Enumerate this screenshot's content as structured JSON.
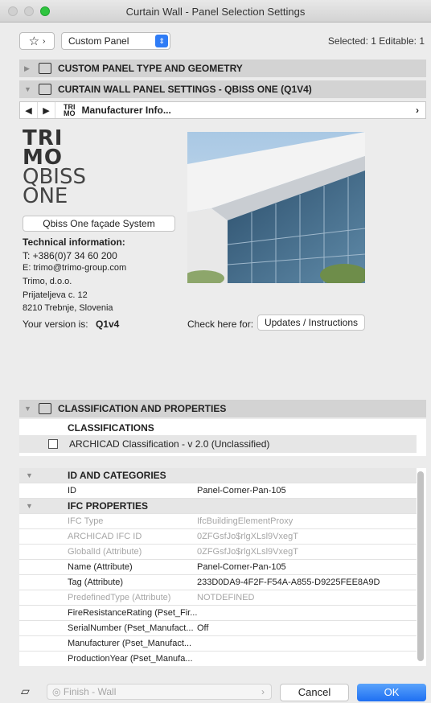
{
  "window": {
    "title": "Curtain Wall - Panel Selection Settings"
  },
  "toolbar": {
    "favorites_icon": "star-icon",
    "panel_type": "Custom Panel",
    "selection_info": "Selected: 1 Editable: 1"
  },
  "sections": {
    "type_geometry": "CUSTOM PANEL TYPE AND GEOMETRY",
    "panel_settings": "CURTAIN WALL PANEL SETTINGS - QBISS ONE (Q1V4)",
    "classification": "CLASSIFICATION AND PROPERTIES"
  },
  "nav": {
    "page_title": "Manufacturer Info...",
    "logo_text": "TRI MO"
  },
  "manufacturer": {
    "logo_lines": [
      "TRI",
      "MO",
      "QBISS",
      "ONE"
    ],
    "system_button": "Qbiss One façade System",
    "tech_header": "Technical information:",
    "phone": "T: +386(0)7 34 60 200",
    "email": "E: trimo@trimo-group.com",
    "company": "Trimo, d.o.o.",
    "street": "Prijateljeva c. 12",
    "city": "8210 Trebnje, Slovenia",
    "version_label": "Your version is:",
    "version_value": "Q1v4",
    "check_label": "Check here for:",
    "updates_button": "Updates / Instructions"
  },
  "classifications": {
    "header": "CLASSIFICATIONS",
    "item": "ARCHICAD Classification - v 2.0 (Unclassified)"
  },
  "properties": {
    "groups": {
      "id_categories": "ID AND CATEGORIES",
      "ifc": "IFC PROPERTIES"
    },
    "rows": [
      {
        "name": "ID",
        "value": "Panel-Corner-Pan-105"
      },
      {
        "name": "IFC Type",
        "value": "IfcBuildingElementProxy"
      },
      {
        "name": "ARCHICAD IFC ID",
        "value": "0ZFGsfJo$rlgXLsl9VxegT"
      },
      {
        "name": "GlobalId (Attribute)",
        "value": "0ZFGsfJo$rlgXLsl9VxegT"
      },
      {
        "name": "Name (Attribute)",
        "value": "Panel-Corner-Pan-105"
      },
      {
        "name": "Tag (Attribute)",
        "value": "233D0DA9-4F2F-F54A-A855-D9225FEE8A9D"
      },
      {
        "name": "PredefinedType (Attribute)",
        "value": "NOTDEFINED"
      },
      {
        "name": "FireResistanceRating (Pset_Fir...",
        "value": ""
      },
      {
        "name": "SerialNumber (Pset_Manufact...",
        "value": "Off"
      },
      {
        "name": "Manufacturer (Pset_Manufact...",
        "value": ""
      },
      {
        "name": "ProductionYear (Pset_Manufa...",
        "value": ""
      }
    ]
  },
  "footer": {
    "finish_value": "Finish - Wall",
    "cancel": "Cancel",
    "ok": "OK"
  },
  "colors": {
    "accent": "#1e6ff2",
    "section_bg": "#d3d3d3"
  }
}
